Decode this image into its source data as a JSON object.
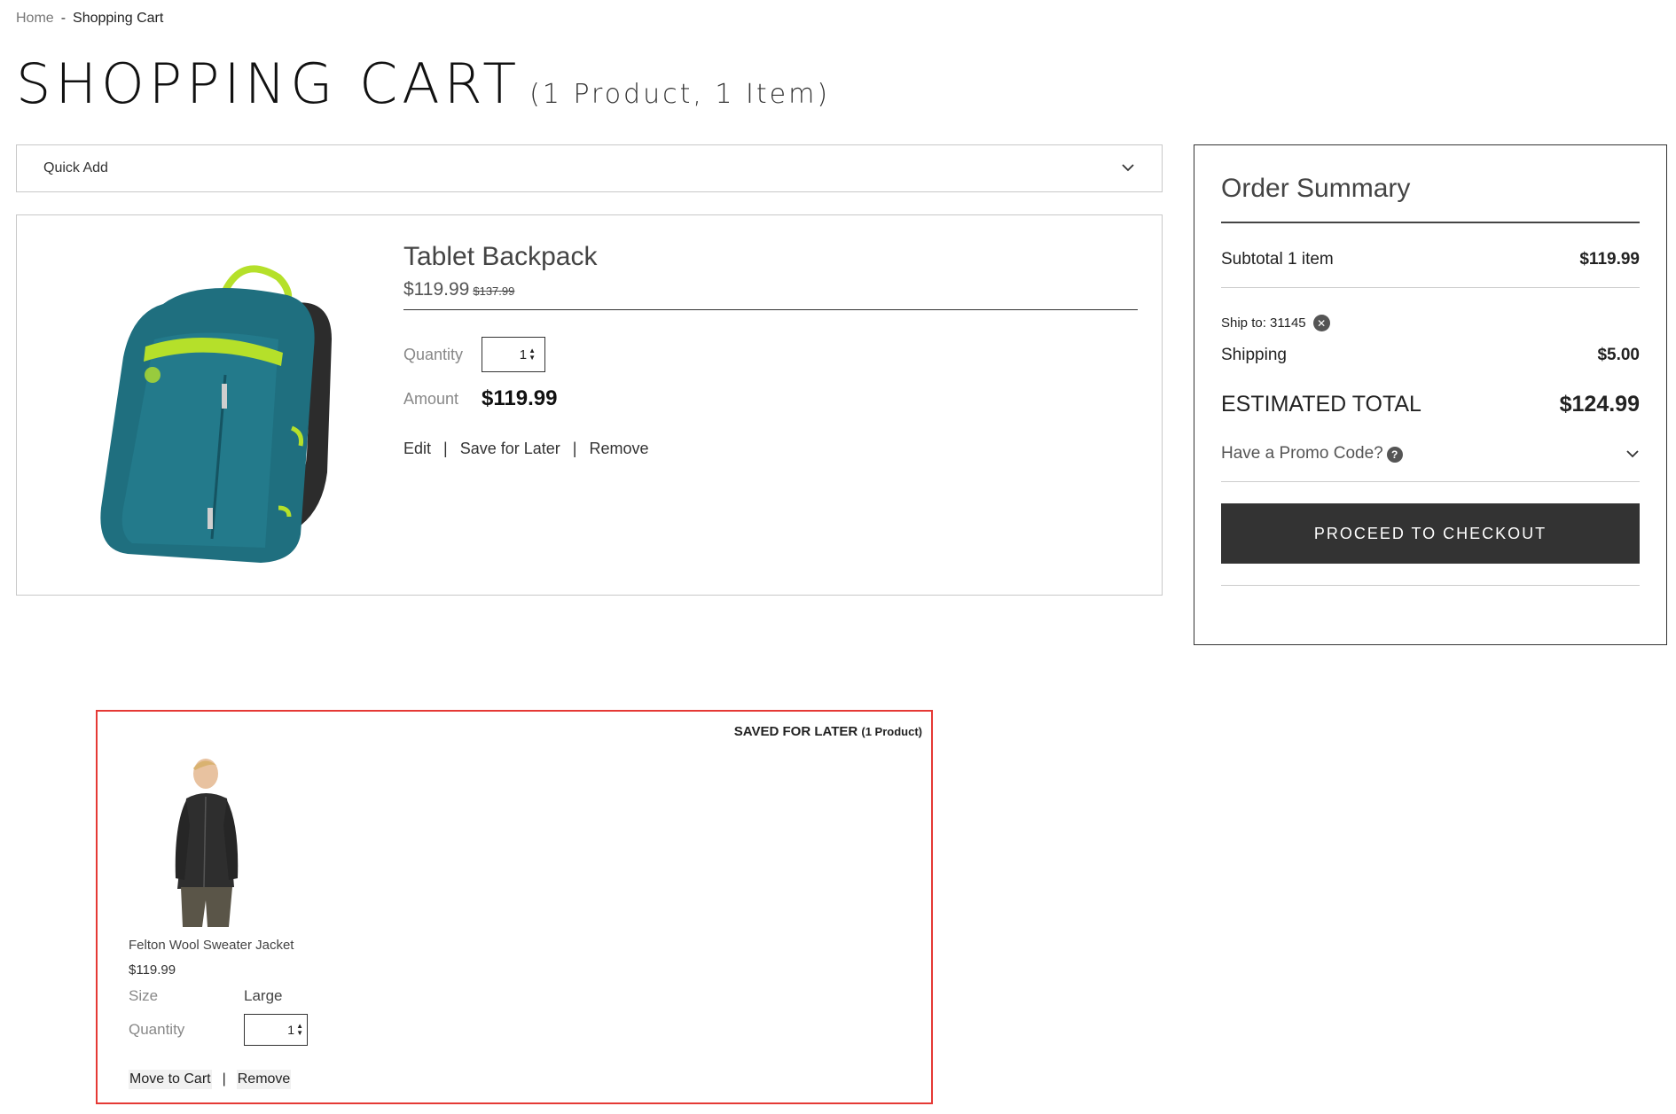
{
  "breadcrumb": {
    "home": "Home",
    "separator": "-",
    "current": "Shopping Cart"
  },
  "page": {
    "title": "SHOPPING CART",
    "subtitle": "(1 Product, 1 Item)"
  },
  "quick_add": {
    "label": "Quick Add",
    "icon": "chevron-down-icon"
  },
  "cart_item": {
    "name": "Tablet Backpack",
    "price": "$119.99",
    "original_price": "$137.99",
    "quantity_label": "Quantity",
    "quantity_value": "1",
    "amount_label": "Amount",
    "amount_value": "$119.99",
    "actions": {
      "edit": "Edit",
      "save_for_later": "Save for Later",
      "remove": "Remove",
      "separator": "|"
    }
  },
  "order_summary": {
    "title": "Order Summary",
    "subtotal_label": "Subtotal 1 item",
    "subtotal_value": "$119.99",
    "ship_to": "Ship to: 31145",
    "shipping_label": "Shipping",
    "shipping_value": "$5.00",
    "estimated_total_label": "ESTIMATED TOTAL",
    "estimated_total_value": "$124.99",
    "promo_label": "Have a Promo Code?",
    "checkout_button": "PROCEED TO CHECKOUT"
  },
  "saved_for_later": {
    "heading": "SAVED FOR LATER",
    "heading_count": "(1 Product)",
    "name": "Felton Wool Sweater Jacket",
    "price": "$119.99",
    "size_label": "Size",
    "size_value": "Large",
    "quantity_label": "Quantity",
    "quantity_value": "1",
    "move_to_cart": "Move to Cart",
    "remove": "Remove",
    "separator": "|"
  },
  "colors": {
    "checkout_button_bg": "#333333",
    "saved_border": "#e53935",
    "backpack": "#1f6f7f",
    "backpack_accent": "#b5e02a"
  }
}
